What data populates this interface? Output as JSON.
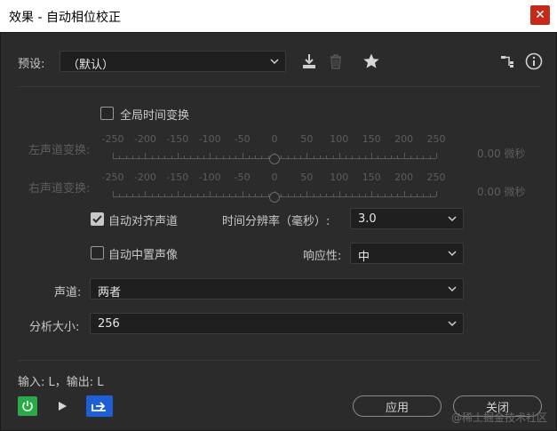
{
  "window": {
    "title": "效果 - 自动相位校正",
    "close_glyph": "✕"
  },
  "preset": {
    "label": "预设:",
    "value": "（默认）"
  },
  "global_time_shift": {
    "label": "全局时间变换",
    "checked": false
  },
  "left_channel": {
    "label": "左声道变换:",
    "ticks": [
      "-250",
      "-200",
      "-150",
      "-100",
      "-50",
      "0",
      "50",
      "100",
      "150",
      "200",
      "250"
    ],
    "value": 0,
    "readout": "0.00 微秒"
  },
  "right_channel": {
    "label": "右声道变换:",
    "ticks": [
      "-250",
      "-200",
      "-150",
      "-100",
      "-50",
      "0",
      "50",
      "100",
      "150",
      "200",
      "250"
    ],
    "value": 0,
    "readout": "0.00 微秒"
  },
  "auto_align": {
    "label": "自动对齐声道",
    "checked": true
  },
  "time_resolution": {
    "label": "时间分辨率（毫秒）:",
    "value": "3.0"
  },
  "auto_center": {
    "label": "自动中置声像",
    "checked": false
  },
  "responsiveness": {
    "label": "响应性:",
    "value": "中"
  },
  "channel": {
    "label": "声道:",
    "value": "两者"
  },
  "analysis_size": {
    "label": "分析大小:",
    "value": "256"
  },
  "io": {
    "text": "输入: L，输出: L"
  },
  "buttons": {
    "apply": "应用",
    "close": "关闭"
  },
  "watermark": "@稀土掘金技术社区",
  "colors": {
    "power_green": "#2aa84a",
    "send_blue": "#1e5fd6"
  }
}
